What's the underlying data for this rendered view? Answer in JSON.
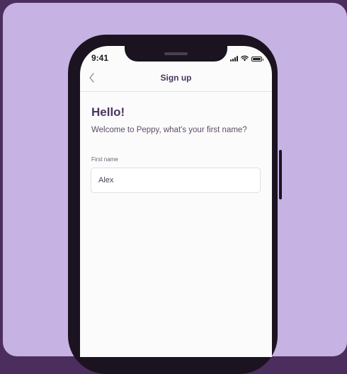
{
  "status_bar": {
    "time": "9:41",
    "icons": [
      "cellular-signal-icon",
      "wifi-icon",
      "battery-icon"
    ]
  },
  "nav": {
    "back_icon": "chevron-left-icon",
    "title": "Sign up"
  },
  "content": {
    "greeting": "Hello!",
    "prompt": "Welcome to Peppy, what's your first name?"
  },
  "form": {
    "first_name_label": "First name",
    "first_name_value": "Alex"
  },
  "colors": {
    "page_background": "#4b2e5e",
    "card_background": "#c6b2e3",
    "device_frame": "#1b1320",
    "brand_text": "#4a3560",
    "screen_background": "#fbfbfb"
  }
}
